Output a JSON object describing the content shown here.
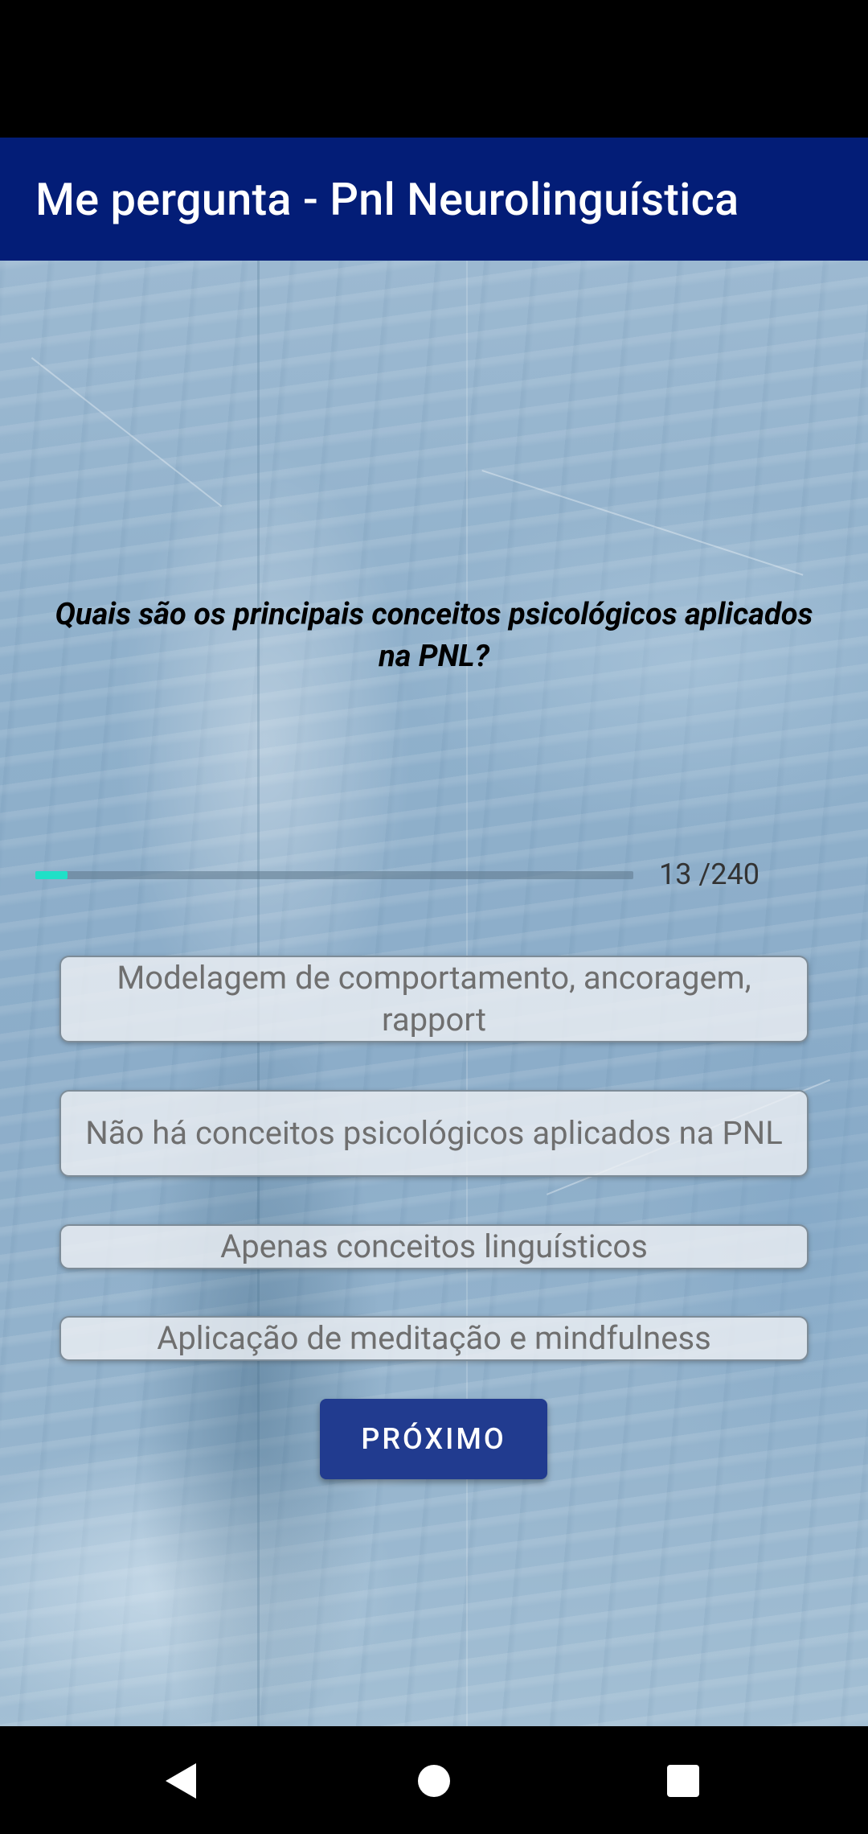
{
  "app_bar": {
    "title": "Me pergunta - Pnl Neurolinguística",
    "background_color": "#031d77"
  },
  "quiz": {
    "question": "Quais são os principais conceitos psicológicos aplicados na PNL?",
    "progress": {
      "current": 13,
      "total": 240,
      "label": "13 /240",
      "fill_color": "#1fe0c7"
    },
    "options": [
      {
        "label": "Modelagem de comportamento, ancoragem, rapport"
      },
      {
        "label": "Não há conceitos psicológicos aplicados na PNL"
      },
      {
        "label": "Apenas conceitos linguísticos"
      },
      {
        "label": "Aplicação de meditação e mindfulness"
      }
    ],
    "next_button": {
      "label": "PRÓXIMO",
      "color": "#213b8f"
    }
  },
  "nav_bar": {
    "icons": [
      "back-icon",
      "home-icon",
      "recents-icon"
    ]
  }
}
